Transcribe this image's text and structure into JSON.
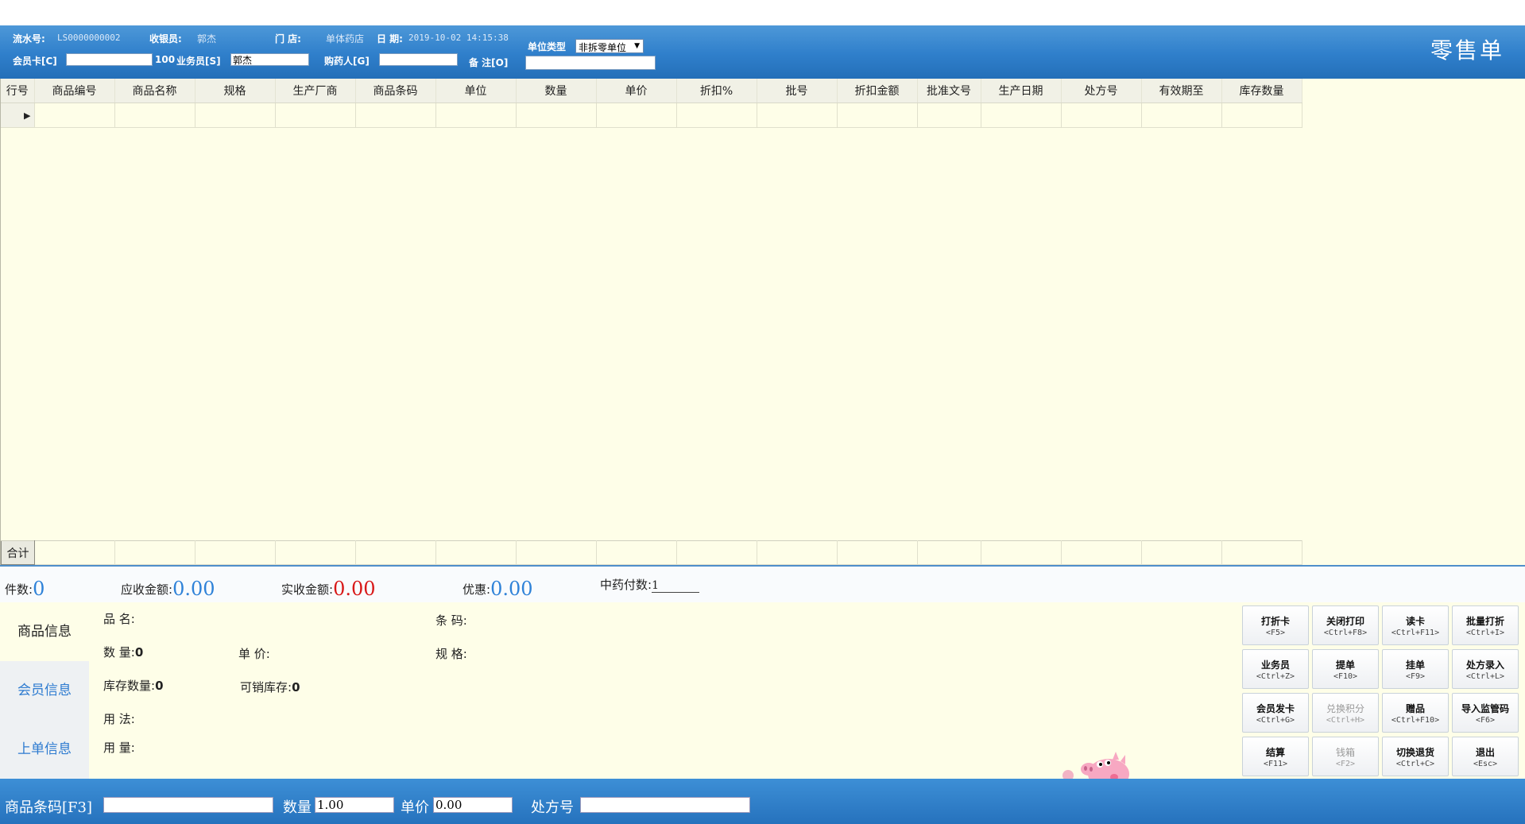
{
  "header": {
    "serial_label": "流水号:",
    "serial_value": "LS0000000002",
    "cashier_label": "收银员:",
    "cashier_value": "郭杰",
    "store_label": "门  店:",
    "store_value": "单体药店",
    "date_label": "日  期:",
    "date_value": "2019-10-02 14:15:38",
    "unit_type_label": "单位类型",
    "unit_type_value": "非拆零单位",
    "member_card_label": "会员卡[C]",
    "member_card_value": "",
    "member_card_suffix": "100",
    "salesman_label": "业务员[S]",
    "salesman_value": "郭杰",
    "buyer_label": "购药人[G]",
    "buyer_value": "",
    "remark_label": "备  注[O]",
    "remark_value": "",
    "doc_title": "零售单"
  },
  "grid": {
    "columns": [
      "行号",
      "商品编号",
      "商品名称",
      "规格",
      "生产厂商",
      "商品条码",
      "单位",
      "数量",
      "单价",
      "折扣%",
      "批号",
      "折扣金额",
      "批准文号",
      "生产日期",
      "处方号",
      "有效期至",
      "库存数量"
    ],
    "row_selector_glyph": "▶",
    "total_label": "合计"
  },
  "summary": {
    "count_label": "件数:",
    "count_value": "0",
    "receivable_label": "应收金额:",
    "receivable_value": "0.00",
    "received_label": "实收金额:",
    "received_value": "0.00",
    "discount_label": "优惠:",
    "discount_value": "0.00",
    "herb_count_label": "中药付数:",
    "herb_count_value": "1"
  },
  "info": {
    "tabs": [
      "商品信息",
      "会员信息",
      "上单信息"
    ],
    "name_label": "品    名:",
    "barcode_label": "条    码:",
    "qty_label": "数    量:",
    "qty_value": "0",
    "price_label": "单    价:",
    "spec_label": "规    格:",
    "stock_label": "库存数量:",
    "stock_value": "0",
    "sellable_label": "可销库存:",
    "sellable_value": "0",
    "usage_label": "用    法:",
    "dosage_label": "用    量:"
  },
  "buttons": [
    {
      "label": "打折卡",
      "key": "<F5>",
      "enabled": true
    },
    {
      "label": "关闭打印",
      "key": "<Ctrl+F8>",
      "enabled": true
    },
    {
      "label": "读卡",
      "key": "<Ctrl+F11>",
      "enabled": true
    },
    {
      "label": "批量打折",
      "key": "<Ctrl+I>",
      "enabled": true
    },
    {
      "label": "业务员",
      "key": "<Ctrl+Z>",
      "enabled": true
    },
    {
      "label": "提单",
      "key": "<F10>",
      "enabled": true
    },
    {
      "label": "挂单",
      "key": "<F9>",
      "enabled": true
    },
    {
      "label": "处方录入",
      "key": "<Ctrl+L>",
      "enabled": true
    },
    {
      "label": "会员发卡",
      "key": "<Ctrl+G>",
      "enabled": true
    },
    {
      "label": "兑换积分",
      "key": "<Ctrl+H>",
      "enabled": false
    },
    {
      "label": "赠品",
      "key": "<Ctrl+F10>",
      "enabled": true
    },
    {
      "label": "导入监管码",
      "key": "<F6>",
      "enabled": true
    },
    {
      "label": "结算",
      "key": "<F11>",
      "enabled": true
    },
    {
      "label": "钱箱",
      "key": "<F2>",
      "enabled": false
    },
    {
      "label": "切换退货",
      "key": "<Ctrl+C>",
      "enabled": true
    },
    {
      "label": "退出",
      "key": "<Esc>",
      "enabled": true
    }
  ],
  "bottom": {
    "barcode_label": "商品条码[F3]",
    "barcode_value": "",
    "qty_label": "数量",
    "qty_value": "1.00",
    "price_label": "单价",
    "price_value": "0.00",
    "rx_label": "处方号",
    "rx_value": ""
  },
  "colors": {
    "header_blue": "#2f7fcb",
    "grid_bg": "#fefee8",
    "amount_blue": "#2f82d8",
    "amount_red": "#d81818"
  }
}
